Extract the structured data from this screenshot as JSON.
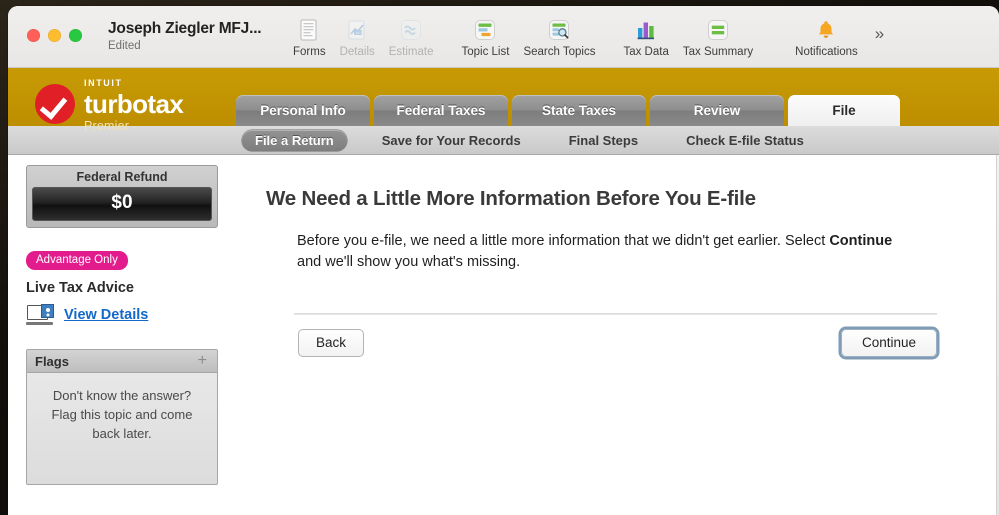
{
  "window": {
    "document_title": "Joseph Ziegler MFJ...",
    "document_status": "Edited"
  },
  "toolbar": {
    "items": [
      {
        "label": "Forms",
        "icon": "forms-icon",
        "enabled": true
      },
      {
        "label": "Details",
        "icon": "details-icon",
        "enabled": false
      },
      {
        "label": "Estimate",
        "icon": "estimate-icon",
        "enabled": false
      },
      {
        "label": "Topic List",
        "icon": "topic-list-icon",
        "enabled": true
      },
      {
        "label": "Search Topics",
        "icon": "search-topics-icon",
        "enabled": true
      },
      {
        "label": "Tax Data",
        "icon": "tax-data-icon",
        "enabled": true
      },
      {
        "label": "Tax Summary",
        "icon": "tax-summary-icon",
        "enabled": true
      },
      {
        "label": "Notifications",
        "icon": "bell-icon",
        "enabled": true
      }
    ],
    "overflow_glyph": "»"
  },
  "brand": {
    "intuit": "INTUIT",
    "product": "turbotax",
    "edition": "Premier",
    "gold": "#bd8f00",
    "badge_red": "#e01f26"
  },
  "main_tabs": [
    {
      "label": "Personal Info",
      "active": false
    },
    {
      "label": "Federal Taxes",
      "active": false
    },
    {
      "label": "State Taxes",
      "active": false
    },
    {
      "label": "Review",
      "active": false
    },
    {
      "label": "File",
      "active": true
    }
  ],
  "sub_nav": [
    {
      "label": "File a Return",
      "selected": true
    },
    {
      "label": "Save for Your Records",
      "selected": false
    },
    {
      "label": "Final Steps",
      "selected": false
    },
    {
      "label": "Check E-file Status",
      "selected": false
    }
  ],
  "sidebar": {
    "refund": {
      "label": "Federal Refund",
      "amount": "$0"
    },
    "advantage": {
      "badge": "Advantage Only",
      "badge_color": "#e31c8d",
      "title": "Live Tax Advice",
      "link": "View Details",
      "link_color": "#1368c9"
    },
    "flags": {
      "title": "Flags",
      "add_glyph": "+",
      "empty_text": "Don't know the answer? Flag this topic and come back later."
    }
  },
  "main": {
    "heading": "We Need a Little More Information Before You E-file",
    "body_part1": "Before you e-file, we need a little more information that we didn't get earlier. Select ",
    "body_emphasis": "Continue",
    "body_part2": " and we'll show you what's missing.",
    "back_button": "Back",
    "continue_button": "Continue"
  }
}
